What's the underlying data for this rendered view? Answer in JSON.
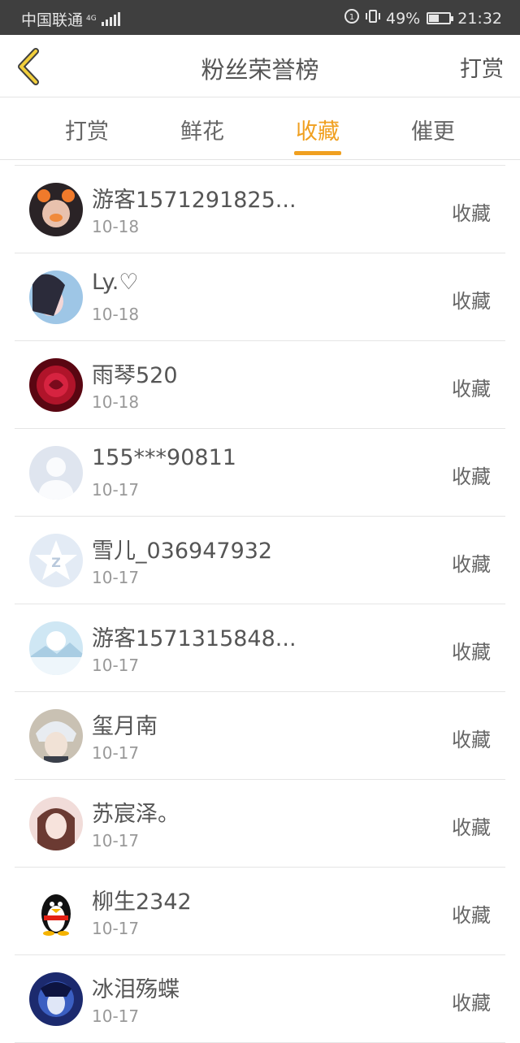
{
  "status_bar": {
    "carrier": "中国联通",
    "network": "4G",
    "battery": "49%",
    "time": "21:32"
  },
  "header": {
    "title": "粉丝荣誉榜",
    "back_icon": "chevron-left-icon",
    "action_label": "打赏"
  },
  "tabs": [
    {
      "label": "打赏"
    },
    {
      "label": "鲜花"
    },
    {
      "label": "收藏"
    },
    {
      "label": "催更"
    }
  ],
  "active_tab": "收藏",
  "accent_color": "#f0a020",
  "fans": [
    {
      "name": "游客1571291825...",
      "date": "10-18",
      "action": "收藏"
    },
    {
      "name": "Ly.♡",
      "date": "10-18",
      "action": "收藏"
    },
    {
      "name": "雨琴520",
      "date": "10-18",
      "action": "收藏"
    },
    {
      "name": "155***90811",
      "date": "10-17",
      "action": "收藏"
    },
    {
      "name": "雪儿_036947932",
      "date": "10-17",
      "action": "收藏"
    },
    {
      "name": "游客1571315848...",
      "date": "10-17",
      "action": "收藏"
    },
    {
      "name": "玺月南",
      "date": "10-17",
      "action": "收藏"
    },
    {
      "name": "苏宸泽。",
      "date": "10-17",
      "action": "收藏"
    },
    {
      "name": "柳生2342",
      "date": "10-17",
      "action": "收藏"
    },
    {
      "name": "冰泪殇蝶",
      "date": "10-17",
      "action": "收藏"
    }
  ]
}
